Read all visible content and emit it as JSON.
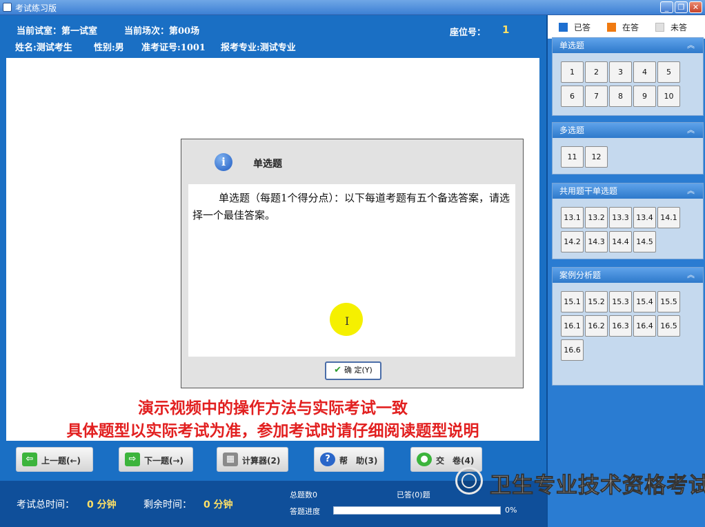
{
  "window": {
    "title": "考试练习版",
    "min": "_",
    "max": "❐",
    "close": "✕"
  },
  "header": {
    "room_label": "当前试室：第一试室",
    "session_label": "当前场次：第00场",
    "seat_label": "座位号：",
    "seat_value": "1",
    "name_label": "姓名:测试考生",
    "gender_label": "性别:男",
    "exam_id_label": "准考证号:1001",
    "major_label": "报考专业:测试专业"
  },
  "dialog": {
    "icon": "info-icon",
    "title": "单选题",
    "body": "单选题（每题1个得分点）：以下每道考题有五个备选答案，请选择一个最佳答案。",
    "ok_label": "确 定(Y)"
  },
  "notice": {
    "line1": "演示视频中的操作方法与实际考试一致",
    "line2": "具体题型以实际考试为准，参加考试时请仔细阅读题型说明"
  },
  "nav": {
    "prev": "上一题(←)",
    "next": "下一题(→)",
    "calc": "计算器(2)",
    "help": "帮　助(3)",
    "submit": "交　卷(4)"
  },
  "footer": {
    "total_time_label": "考试总时间：",
    "total_time_value": "0 分钟",
    "remaining_label": "剩余时间：",
    "remaining_value": "0 分钟",
    "total_questions": "总题数0",
    "answered": "已答(0)题",
    "progress_label": "答题进度",
    "progress_value": "0%",
    "progress_fraction": 0
  },
  "legend": {
    "answered": {
      "label": "已答",
      "color": "#1e6fd0"
    },
    "current": {
      "label": "在答",
      "color": "#f07a10"
    },
    "unanswered": {
      "label": "未答",
      "color": "#e0e0e0"
    }
  },
  "sections": {
    "single": {
      "title": "单选题",
      "items": [
        "1",
        "2",
        "3",
        "4",
        "5",
        "6",
        "7",
        "8",
        "9",
        "10"
      ]
    },
    "multi": {
      "title": "多选题",
      "items": [
        "11",
        "12"
      ]
    },
    "shared": {
      "title": "共用题干单选题",
      "items": [
        "13.1",
        "13.2",
        "13.3",
        "13.4",
        "14.1",
        "14.2",
        "14.3",
        "14.4",
        "14.5"
      ]
    },
    "case": {
      "title": "案例分析题",
      "items": [
        "15.1",
        "15.2",
        "15.3",
        "15.4",
        "15.5",
        "16.1",
        "16.2",
        "16.3",
        "16.4",
        "16.5",
        "16.6"
      ]
    },
    "collapse": "︽"
  },
  "watermark": {
    "text": "卫生专业技术资格考试"
  }
}
